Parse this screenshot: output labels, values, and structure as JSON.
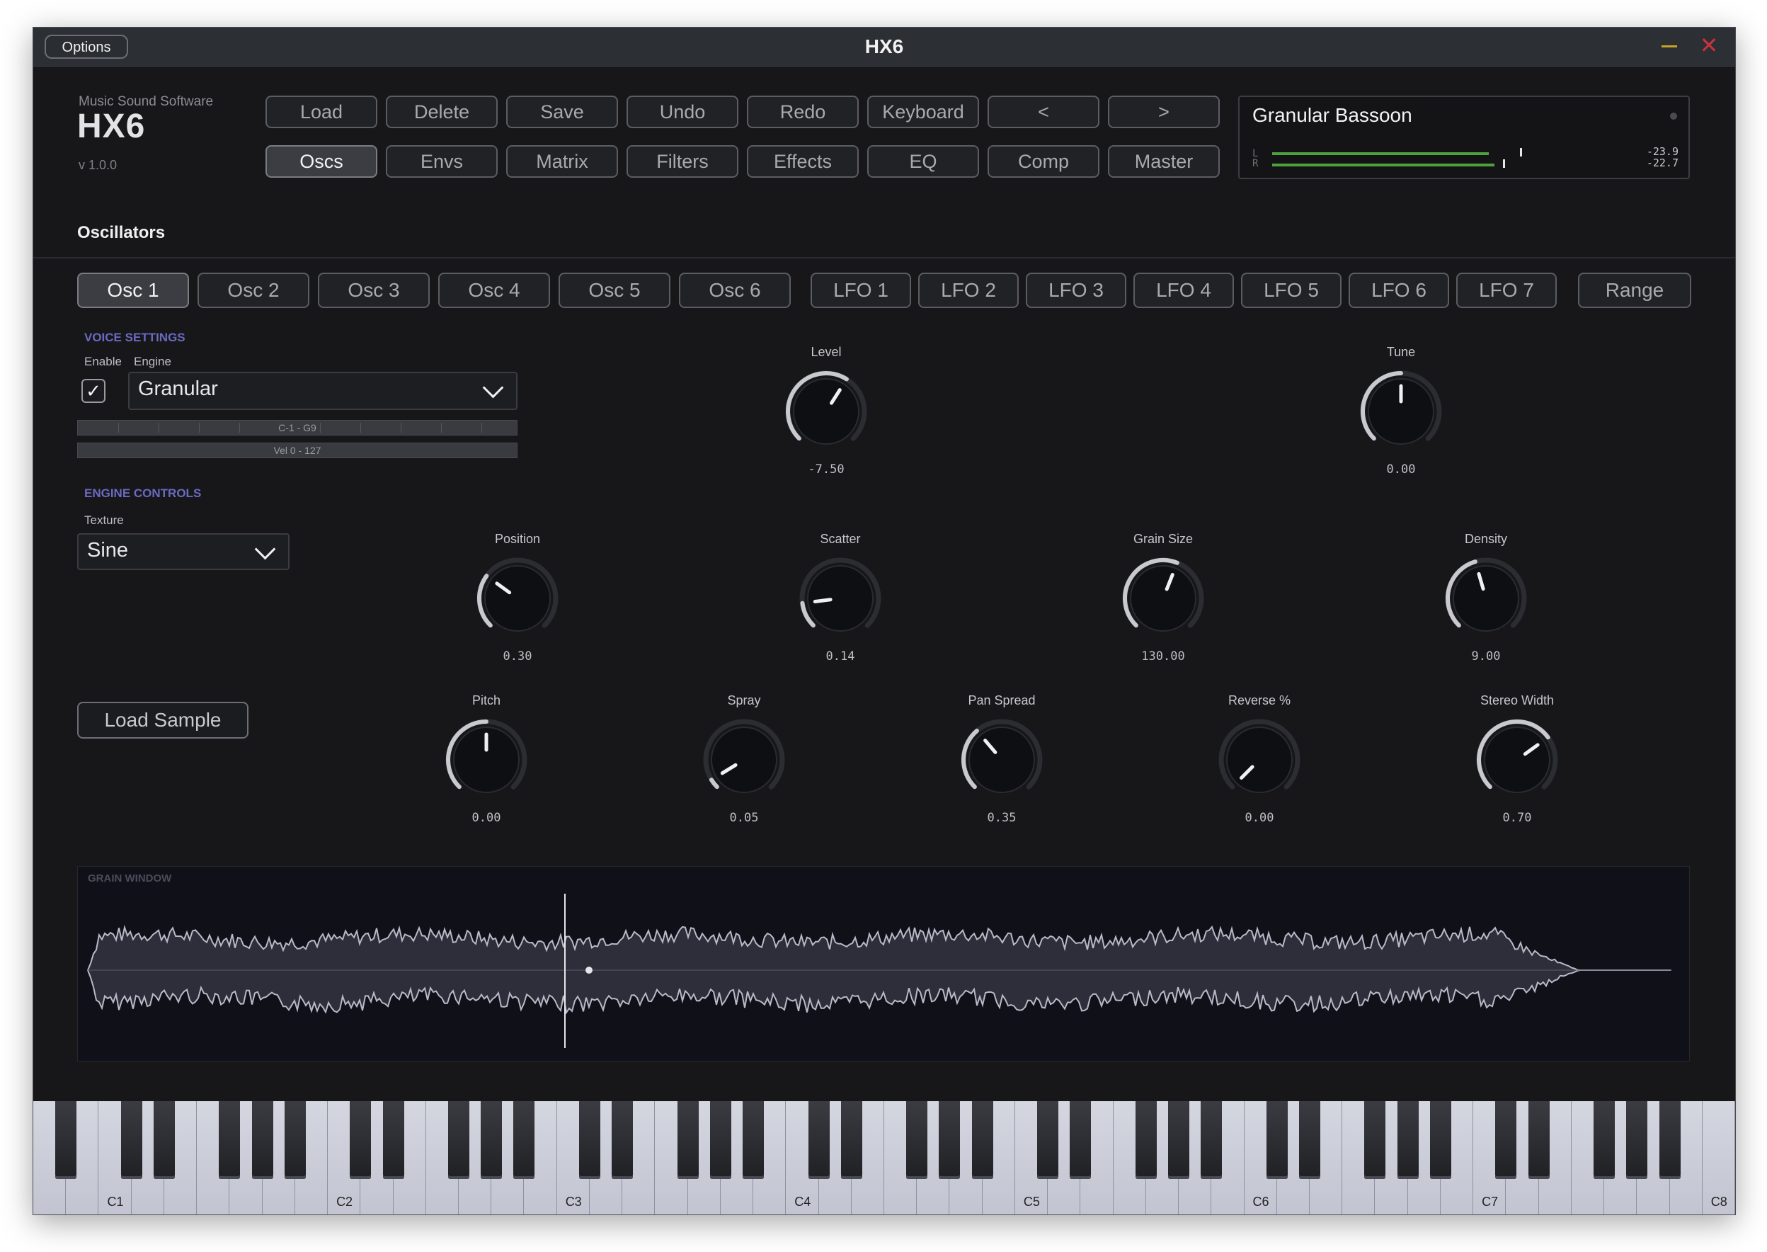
{
  "window": {
    "title": "HX6",
    "options_label": "Options"
  },
  "brand": {
    "company": "Music Sound Software",
    "logo": "HX6",
    "version": "v 1.0.0"
  },
  "toolbar_row1": [
    "Load",
    "Delete",
    "Save",
    "Undo",
    "Redo",
    "Keyboard",
    "<",
    ">"
  ],
  "toolbar_row2": [
    "Oscs",
    "Envs",
    "Matrix",
    "Filters",
    "Effects",
    "EQ",
    "Comp",
    "Master"
  ],
  "toolbar_active": "Oscs",
  "preset": {
    "name": "Granular Bassoon",
    "meter_left_label": "L",
    "meter_right_label": "R",
    "meter_left_value": "-23.9",
    "meter_right_value": "-22.7"
  },
  "section_title": "Oscillators",
  "osc_tabs": [
    "Osc 1",
    "Osc 2",
    "Osc 3",
    "Osc 4",
    "Osc 5",
    "Osc 6"
  ],
  "lfo_tabs": [
    "LFO 1",
    "LFO 2",
    "LFO 3",
    "LFO 4",
    "LFO 5",
    "LFO 6",
    "LFO 7"
  ],
  "range_tab": "Range",
  "voice_settings": {
    "header": "VOICE SETTINGS",
    "enable_label": "Enable",
    "engine_label": "Engine",
    "enabled": true,
    "engine_value": "Granular",
    "key_range": "C-1 - G9",
    "vel_range": "Vel 0 - 127"
  },
  "engine_controls": {
    "header": "ENGINE CONTROLS",
    "texture_label": "Texture",
    "texture_value": "Sine",
    "load_sample_label": "Load Sample"
  },
  "knobs": {
    "level": {
      "label": "Level",
      "value": "-7.50",
      "fraction": 0.62
    },
    "tune": {
      "label": "Tune",
      "value": "0.00",
      "fraction": 0.5
    },
    "position": {
      "label": "Position",
      "value": "0.30",
      "fraction": 0.3
    },
    "scatter": {
      "label": "Scatter",
      "value": "0.14",
      "fraction": 0.14
    },
    "grain_size": {
      "label": "Grain Size",
      "value": "130.00",
      "fraction": 0.58
    },
    "density": {
      "label": "Density",
      "value": "9.00",
      "fraction": 0.44
    },
    "pitch": {
      "label": "Pitch",
      "value": "0.00",
      "fraction": 0.5
    },
    "spray": {
      "label": "Spray",
      "value": "0.05",
      "fraction": 0.05
    },
    "pan_spread": {
      "label": "Pan Spread",
      "value": "0.35",
      "fraction": 0.35
    },
    "reverse": {
      "label": "Reverse %",
      "value": "0.00",
      "fraction": 0.0
    },
    "stereo_width": {
      "label": "Stereo Width",
      "value": "0.70",
      "fraction": 0.7
    }
  },
  "grain_window": {
    "title": "GRAIN WINDOW"
  },
  "keyboard": {
    "octave_labels": [
      "C1",
      "C2",
      "C3",
      "C4",
      "C5",
      "C6",
      "C7",
      "C8"
    ]
  },
  "colors": {
    "accent": "#6a6ac0",
    "meter_green": "#4ea23c",
    "close_red": "#c8323a",
    "minimize_yellow": "#c9a227"
  }
}
